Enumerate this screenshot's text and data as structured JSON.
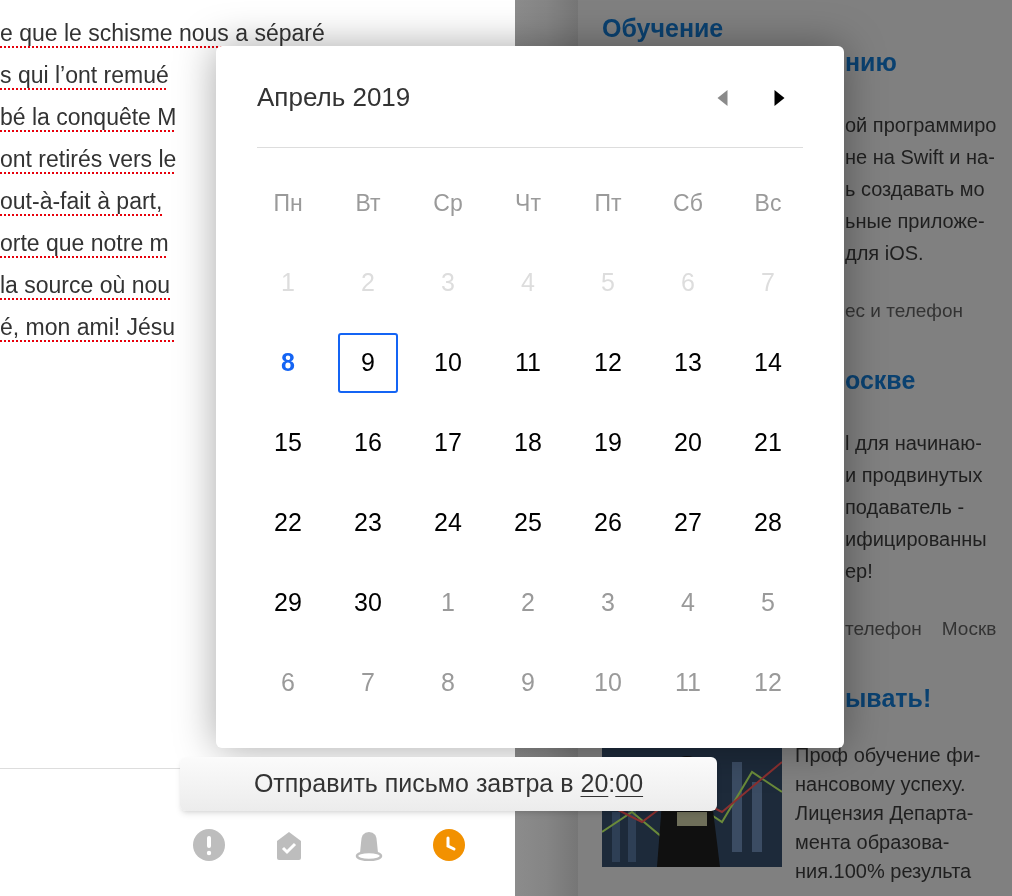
{
  "editor": {
    "lines": [
      "e que le schisme nous a séparé",
      "s qui l’ont remué",
      "bé la conquête M",
      "ont retirés vers le",
      "out-à-fait à part,",
      "orte que notre m",
      "la source où nou",
      "é, mon ami! Jésu"
    ]
  },
  "ads": [
    {
      "title": [
        {
          "text": "Обучение",
          "partly_hidden": false
        },
        {
          "text": "нию",
          "partly_hidden": true
        }
      ],
      "body": [
        {
          "text": "ой программиро",
          "partly_hidden": true
        },
        {
          "text": "не на Swift и на-",
          "partly_hidden": true
        },
        {
          "text": "ь создавать мо",
          "partly_hidden": true
        },
        {
          "text": "ьные приложе-",
          "partly_hidden": true
        },
        {
          "text": "для iOS.",
          "partly_hidden": true
        }
      ],
      "meta": [
        "ес и телефон"
      ]
    },
    {
      "title": [
        {
          "text": "оскве",
          "partly_hidden": true
        }
      ],
      "body": [
        {
          "text": "l для начинаю-",
          "partly_hidden": true
        },
        {
          "text": "и продвинутых",
          "partly_hidden": true
        },
        {
          "text": "подаватель -",
          "partly_hidden": true
        },
        {
          "text": "ифицированны",
          "partly_hidden": true
        },
        {
          "text": "ер!",
          "partly_hidden": true
        }
      ],
      "meta": [
        "телефон",
        "Москв"
      ]
    },
    {
      "title": [
        {
          "text": "ывать!",
          "partly_hidden": true
        }
      ],
      "picture": {
        "kind": "picture"
      },
      "body": [
        {
          "text": "Проф обучение фи-",
          "partly_hidden": false
        },
        {
          "text": "нансовому успеху.",
          "partly_hidden": false
        },
        {
          "text": "Лицензия Департа-",
          "partly_hidden": false
        },
        {
          "text": "мента образова-",
          "partly_hidden": false
        },
        {
          "text": "ния.100% результа",
          "partly_hidden": false
        }
      ]
    }
  ],
  "calendar": {
    "month": "Апрель 2019",
    "prev_enabled": false,
    "next_enabled": true,
    "weekdays": [
      "Пн",
      "Вт",
      "Ср",
      "Чт",
      "Пт",
      "Сб",
      "Вс"
    ],
    "days": [
      {
        "label": "1",
        "kind": "past",
        "selected": false
      },
      {
        "label": "2",
        "kind": "past",
        "selected": false
      },
      {
        "label": "3",
        "kind": "past",
        "selected": false
      },
      {
        "label": "4",
        "kind": "past",
        "selected": false
      },
      {
        "label": "5",
        "kind": "past",
        "selected": false
      },
      {
        "label": "6",
        "kind": "past",
        "selected": false
      },
      {
        "label": "7",
        "kind": "past",
        "selected": false
      },
      {
        "label": "8",
        "kind": "today",
        "selected": false
      },
      {
        "label": "9",
        "kind": "current",
        "selected": true
      },
      {
        "label": "10",
        "kind": "current",
        "selected": false
      },
      {
        "label": "11",
        "kind": "current",
        "selected": false
      },
      {
        "label": "12",
        "kind": "current",
        "selected": false
      },
      {
        "label": "13",
        "kind": "current",
        "selected": false
      },
      {
        "label": "14",
        "kind": "current",
        "selected": false
      },
      {
        "label": "15",
        "kind": "current",
        "selected": false
      },
      {
        "label": "16",
        "kind": "current",
        "selected": false
      },
      {
        "label": "17",
        "kind": "current",
        "selected": false
      },
      {
        "label": "18",
        "kind": "current",
        "selected": false
      },
      {
        "label": "19",
        "kind": "current",
        "selected": false
      },
      {
        "label": "20",
        "kind": "current",
        "selected": false
      },
      {
        "label": "21",
        "kind": "current",
        "selected": false
      },
      {
        "label": "22",
        "kind": "current",
        "selected": false
      },
      {
        "label": "23",
        "kind": "current",
        "selected": false
      },
      {
        "label": "24",
        "kind": "current",
        "selected": false
      },
      {
        "label": "25",
        "kind": "current",
        "selected": false
      },
      {
        "label": "26",
        "kind": "current",
        "selected": false
      },
      {
        "label": "27",
        "kind": "current",
        "selected": false
      },
      {
        "label": "28",
        "kind": "current",
        "selected": false
      },
      {
        "label": "29",
        "kind": "current",
        "selected": false
      },
      {
        "label": "30",
        "kind": "current",
        "selected": false
      },
      {
        "label": "1",
        "kind": "next",
        "selected": false
      },
      {
        "label": "2",
        "kind": "next",
        "selected": false
      },
      {
        "label": "3",
        "kind": "next",
        "selected": false
      },
      {
        "label": "4",
        "kind": "next",
        "selected": false
      },
      {
        "label": "5",
        "kind": "next",
        "selected": false
      },
      {
        "label": "6",
        "kind": "next",
        "selected": false
      },
      {
        "label": "7",
        "kind": "next",
        "selected": false
      },
      {
        "label": "8",
        "kind": "next",
        "selected": false
      },
      {
        "label": "9",
        "kind": "next",
        "selected": false
      },
      {
        "label": "10",
        "kind": "next",
        "selected": false
      },
      {
        "label": "11",
        "kind": "next",
        "selected": false
      },
      {
        "label": "12",
        "kind": "next",
        "selected": false
      }
    ]
  },
  "schedule_tooltip": {
    "label": "Отправить письмо завтра в",
    "hours": "20",
    "separator": ":",
    "minutes": "00"
  },
  "toolbar": [
    {
      "kind": "important",
      "selected": false
    },
    {
      "kind": "receipt",
      "selected": false
    },
    {
      "kind": "reminder",
      "selected": false
    },
    {
      "kind": "delayed",
      "selected": true
    }
  ]
}
